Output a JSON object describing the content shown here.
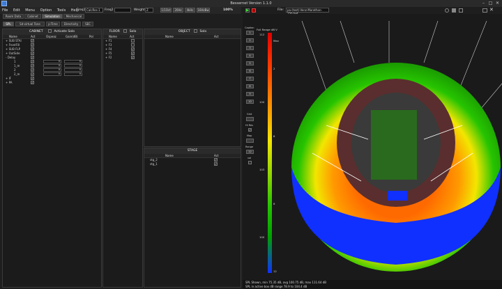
{
  "window": {
    "title": "Bessernet Version 1.1.0",
    "minimize": "–",
    "maximize": "□",
    "close": "✕"
  },
  "menu": [
    "File",
    "Edit",
    "Menu",
    "Option",
    "Tools",
    "Help"
  ],
  "toolbar": {
    "freq1_label": "Freq1",
    "freq1_value": "CalcRes-1",
    "freq2_label": "Freq2",
    "freq2_value": "",
    "weight_label": "Weight",
    "weight_value": "Z",
    "band_buttons": [
      "1/1Oct",
      "20Hz",
      "4kHz",
      "16HzBw"
    ],
    "percent": "100%"
  },
  "tabs_top": [
    "Room Data",
    "Cabinet",
    "Simulation",
    "Mechanical"
  ],
  "tabs_sub": [
    "SPL",
    "Sd-virtual Tone",
    "p-Time",
    "Directivity",
    "SEC"
  ],
  "cabinet_panel": {
    "title": "CABINET",
    "activate_solo": "Activate Solo",
    "columns": [
      "Name",
      "Act",
      "Ospeaz",
      "Gain(dB)",
      "Pol"
    ],
    "rows": [
      {
        "name": "+ SUB STAI",
        "checked": true
      },
      {
        "name": "+ FrontFill",
        "checked": true
      },
      {
        "name": "+ SUB FLP",
        "checked": true
      },
      {
        "name": "+ OutSide",
        "checked": true
      },
      {
        "name": "- Delay",
        "checked": true
      },
      {
        "name": "1",
        "checked": true,
        "d": "0",
        "g": "0"
      },
      {
        "name": "1_m",
        "checked": true,
        "d": "0",
        "g": "0"
      },
      {
        "name": "2",
        "checked": true,
        "d": "0",
        "g": "0"
      },
      {
        "name": "2_m",
        "checked": true,
        "d": "0",
        "g": "0"
      },
      {
        "name": "+ IF",
        "checked": true
      },
      {
        "name": "+ PA",
        "checked": true
      }
    ]
  },
  "floor_panel": {
    "title": "FLOOR",
    "solo": "Solo",
    "columns": [
      "Name",
      "Act"
    ],
    "rows": [
      {
        "name": "+ F1",
        "checked": false
      },
      {
        "name": "+ F3",
        "checked": false
      },
      {
        "name": "+ F4",
        "checked": true
      },
      {
        "name": "+ F5",
        "checked": true
      },
      {
        "name": "+ F2",
        "checked": true
      }
    ]
  },
  "object_panel": {
    "title": "OBJECT",
    "solo": "Solo",
    "columns": [
      "Name",
      "Act"
    ]
  },
  "stage_panel": {
    "title": "STAGE",
    "columns": [
      "Name",
      "Act"
    ],
    "rows": [
      {
        "name": "stg_2",
        "checked": true
      },
      {
        "name": "stg_1",
        "checked": true
      }
    ]
  },
  "viewer_top": {
    "file_label": "File:",
    "file_value": "pa-(test)-Venz-Marathon-15b.bet"
  },
  "legend": {
    "title": "Full Range dB V",
    "max": "Max",
    "ticks": [
      "112",
      "2",
      "100",
      "8",
      "103",
      "6",
      "100",
      "12"
    ]
  },
  "side_controls": {
    "caption": "Caption",
    "grid": "Grid",
    "hi_res": "Hi Res",
    "map": "Map",
    "range": "Range",
    "range_value": "12",
    "val": "val",
    "buttons": [
      "1",
      "2",
      "3",
      "4",
      "5",
      "6",
      "7",
      "8",
      "9",
      "10"
    ]
  },
  "status": {
    "line1": "SPL Shown, min 75.35 dB, avg 100.75 dB, max 111.64 dB",
    "line2": "SPL in active box dB range 78.9 to 104.4 dB"
  },
  "colors": {
    "red": "#e00000",
    "orange": "#ff7a00",
    "yellow": "#f2e600",
    "green": "#26c400",
    "blue": "#1030ff",
    "field": "#2a6a1e",
    "track": "#5a2e2e"
  }
}
